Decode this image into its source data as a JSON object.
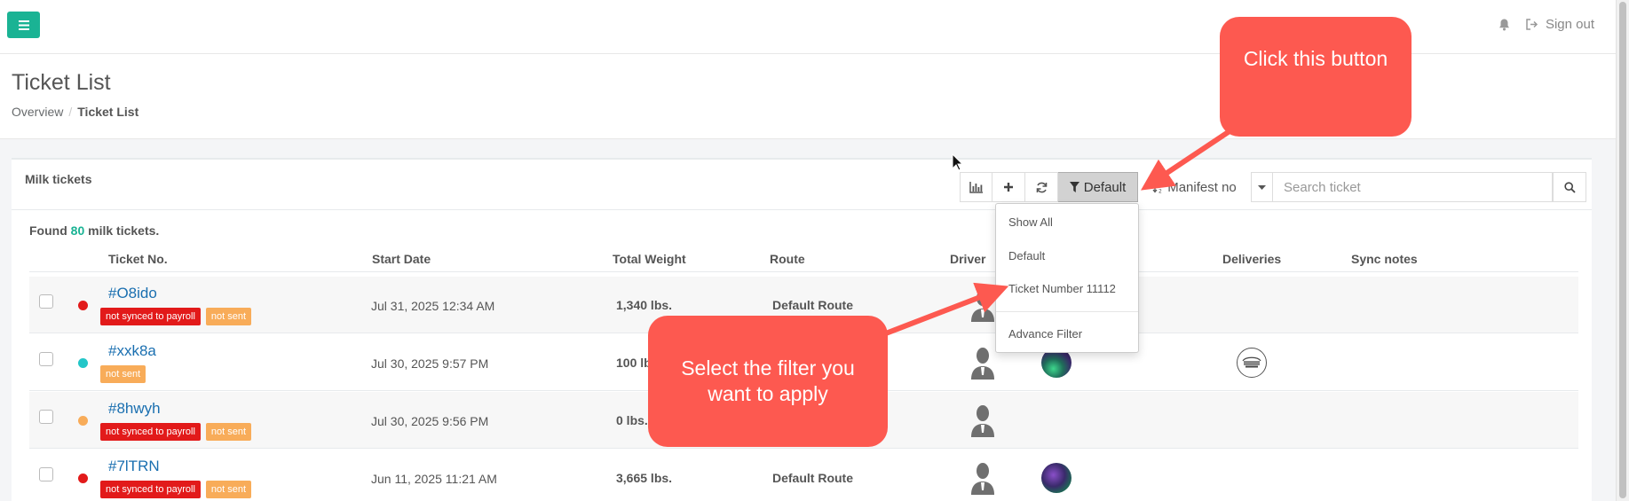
{
  "header": {
    "menu_icon": "hamburger-icon",
    "bell_icon": "bell-icon",
    "signout_icon": "sign-out-icon",
    "signout_label": "Sign out"
  },
  "page": {
    "title": "Ticket List",
    "breadcrumb": [
      "Overview",
      "Ticket List"
    ]
  },
  "panel": {
    "title": "Milk tickets",
    "toolbar": {
      "chart_icon": "bar-chart-icon",
      "add_icon": "plus-icon",
      "refresh_icon": "refresh-icon",
      "filter_icon": "filter-icon",
      "filter_label": "Default",
      "sort_icon": "sort-numeric-icon",
      "sort_label": "Manifest no",
      "caret_icon": "caret-down-icon",
      "search_placeholder": "Search ticket",
      "search_icon": "search-icon"
    },
    "found_prefix": "Found",
    "found_count": "80",
    "found_suffix": "milk tickets.",
    "columns": [
      "Ticket No.",
      "Start Date",
      "Total Weight",
      "Route",
      "Driver",
      "Deliveries",
      "Sync notes"
    ],
    "rows": [
      {
        "status_color": "#e21a1a",
        "ticket": "#O8ido",
        "badges": [
          "not synced to payroll",
          "not sent"
        ],
        "start": "Jul 31, 2025 12:34 AM",
        "weight": "1,340 lbs.",
        "route": "Default Route"
      },
      {
        "status_color": "#23c6c8",
        "ticket": "#xxk8a",
        "badges": [
          "not sent"
        ],
        "start": "Jul 30, 2025 9:57 PM",
        "weight": "100 lbs.",
        "route": ""
      },
      {
        "status_color": "#f8ac59",
        "ticket": "#8hwyh",
        "badges": [
          "not synced to payroll",
          "not sent"
        ],
        "start": "Jul 30, 2025 9:56 PM",
        "weight": "0 lbs.",
        "route": ""
      },
      {
        "status_color": "#e21a1a",
        "ticket": "#7lTRN",
        "badges": [
          "not synced to payroll",
          "not sent"
        ],
        "start": "Jun 11, 2025 11:21 AM",
        "weight": "3,665 lbs.",
        "route": "Default Route"
      }
    ]
  },
  "dropdown": {
    "items": [
      "Show All",
      "Default",
      "Ticket Number 11112"
    ],
    "advance": "Advance Filter"
  },
  "annotations": {
    "callout_button": "Click this button",
    "callout_filter": "Select the filter you want to apply",
    "color": "#fd5950"
  }
}
